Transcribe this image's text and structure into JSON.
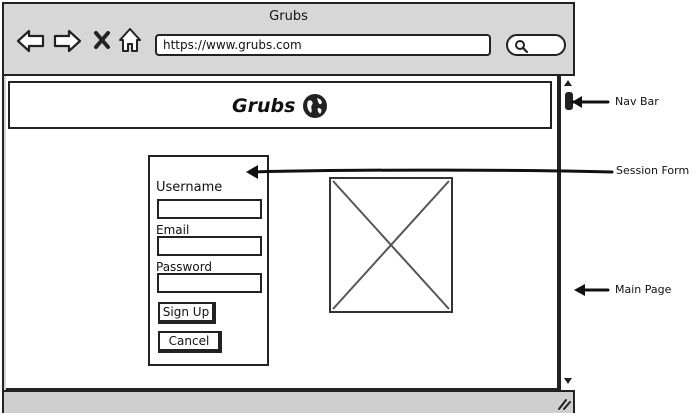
{
  "window": {
    "title": "Grubs"
  },
  "address_bar": {
    "url": "https://www.grubs.com"
  },
  "page": {
    "brand_name": "Grubs"
  },
  "session_form": {
    "username_label": "Username",
    "email_label": "Email",
    "password_label": "Password",
    "signup_label": "Sign Up",
    "cancel_label": "Cancel"
  },
  "annotations": {
    "nav_bar": "Nav Bar",
    "session_form": "Session Form",
    "main_page": "Main Page"
  },
  "icons": [
    "back-arrow-icon",
    "forward-arrow-icon",
    "close-icon",
    "home-icon",
    "search-icon",
    "globe-icon",
    "resize-grip-icon"
  ]
}
